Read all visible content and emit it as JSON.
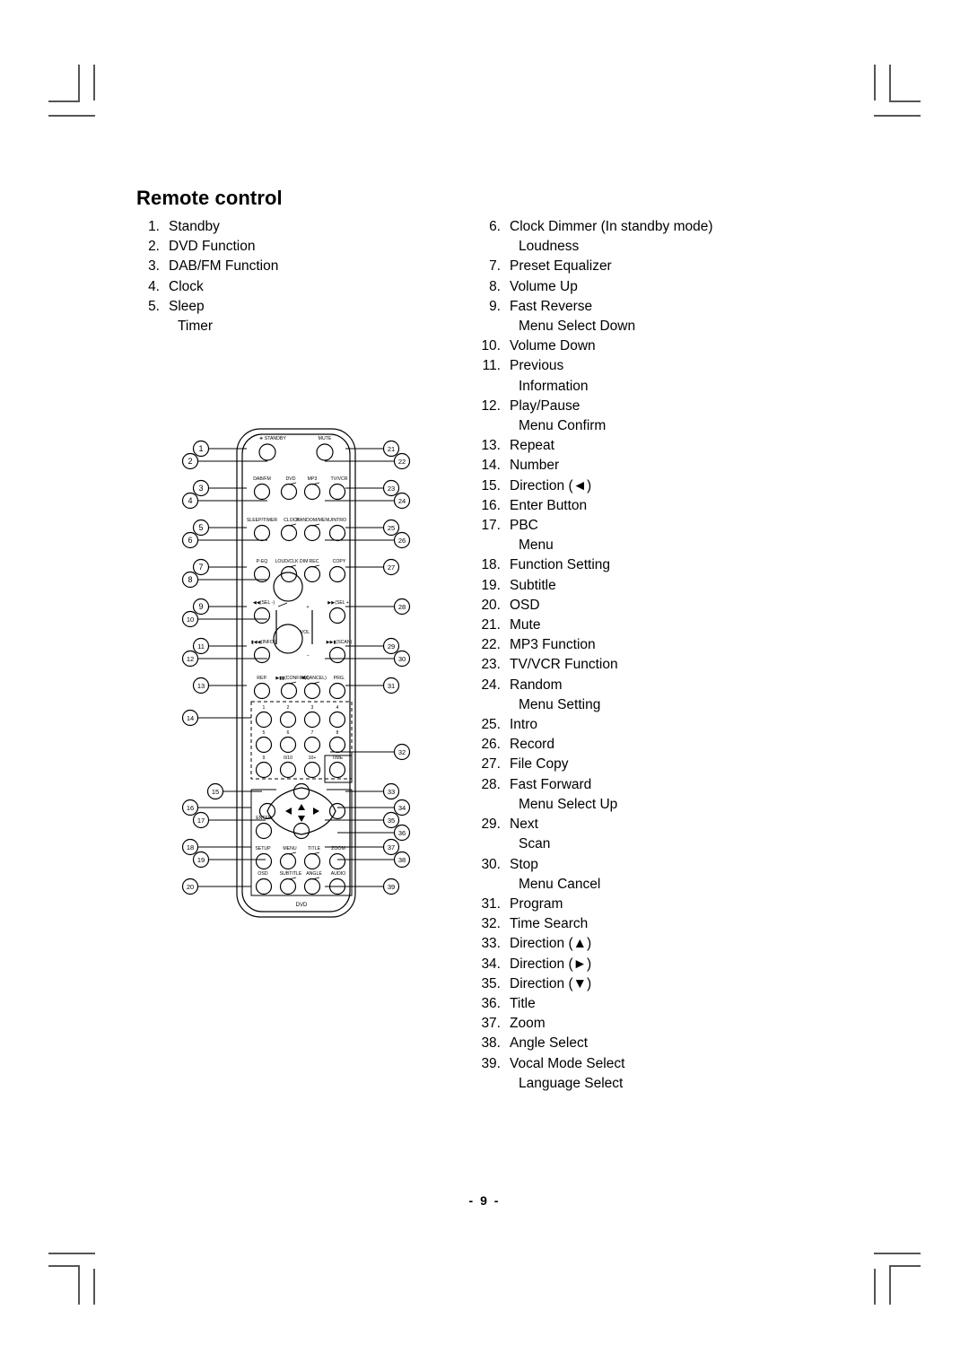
{
  "document": {
    "page_title": "Remote control",
    "page_number": "-  9  -"
  },
  "left_column": [
    {
      "num": "1.",
      "label": "Standby"
    },
    {
      "num": "2.",
      "label": "DVD Function"
    },
    {
      "num": "3.",
      "label": "DAB/FM Function"
    },
    {
      "num": "4.",
      "label": "Clock"
    },
    {
      "num": "5.",
      "label": "Sleep",
      "sub": "Timer"
    }
  ],
  "right_column": [
    {
      "num": "6.",
      "label": "Clock Dimmer (In standby mode)",
      "sub": "Loudness"
    },
    {
      "num": "7.",
      "label": "Preset Equalizer"
    },
    {
      "num": "8.",
      "label": "Volume Up"
    },
    {
      "num": "9.",
      "label": "Fast Reverse",
      "sub": "Menu Select Down"
    },
    {
      "num": "10.",
      "label": "Volume Down"
    },
    {
      "num": "11.",
      "label": "Previous",
      "sub": "Information"
    },
    {
      "num": "12.",
      "label": "Play/Pause",
      "sub": "Menu Confirm"
    },
    {
      "num": "13.",
      "label": "Repeat"
    },
    {
      "num": "14.",
      "label": "Number"
    },
    {
      "num": "15.",
      "label": "Direction  (◄)"
    },
    {
      "num": "16.",
      "label": "Enter Button"
    },
    {
      "num": "17.",
      "label": "PBC",
      "sub": "Menu"
    },
    {
      "num": "18.",
      "label": "Function Setting"
    },
    {
      "num": "19.",
      "label": "Subtitle"
    },
    {
      "num": "20.",
      "label": "OSD"
    },
    {
      "num": "21.",
      "label": "Mute"
    },
    {
      "num": "22.",
      "label": "MP3 Function"
    },
    {
      "num": "23.",
      "label": "TV/VCR Function"
    },
    {
      "num": "24.",
      "label": "Random",
      "sub": "Menu Setting"
    },
    {
      "num": "25.",
      "label": "Intro"
    },
    {
      "num": "26.",
      "label": "Record"
    },
    {
      "num": "27.",
      "label": "File Copy"
    },
    {
      "num": "28.",
      "label": "Fast Forward",
      "sub": "Menu Select Up"
    },
    {
      "num": "29.",
      "label": "Next",
      "sub": "Scan"
    },
    {
      "num": "30.",
      "label": "Stop",
      "sub": "Menu Cancel"
    },
    {
      "num": "31.",
      "label": "Program"
    },
    {
      "num": "32.",
      "label": "Time Search"
    },
    {
      "num": "33.",
      "label": "Direction  (▲)"
    },
    {
      "num": "34.",
      "label": "Direction  (►)"
    },
    {
      "num": "35.",
      "label": "Direction  (▼)"
    },
    {
      "num": "36.",
      "label": "Title"
    },
    {
      "num": "37.",
      "label": "Zoom"
    },
    {
      "num": "38.",
      "label": "Angle Select"
    },
    {
      "num": "39.",
      "label": "Vocal Mode Select",
      "sub": "Language Select"
    }
  ],
  "remote_diagram": {
    "button_labels": [
      "STANDBY",
      "MUTE",
      "DAB/FM",
      "DVD",
      "MP3",
      "TV/VCR",
      "SLEEP/TIMER",
      "CLOCK",
      "RANDOM/MENU",
      "INTRO",
      "P-EQ",
      "LOUD/CLK DIM",
      "REC",
      "COPY",
      "(SEL -)",
      "(SEL +)",
      "(INFO.)",
      "(SCAN)",
      "VOL",
      "+",
      "−",
      "REP.",
      "(CONFIRM)",
      "(CANCEL)",
      "PRG.",
      "1",
      "2",
      "3",
      "4",
      "5",
      "6",
      "7",
      "8",
      "9",
      "0/10",
      "10+",
      "TIME",
      "ENTER",
      "SETUP",
      "MENU",
      "TITLE",
      "ZOOM",
      "OSD",
      "SUBTITLE",
      "ANGLE",
      "AUDIO",
      "DVD"
    ],
    "callouts_left": [
      "1",
      "2",
      "3",
      "4",
      "5",
      "6",
      "7",
      "8",
      "9",
      "10",
      "11",
      "12",
      "13",
      "14",
      "15",
      "16",
      "17",
      "18",
      "19",
      "20"
    ],
    "callouts_right": [
      "21",
      "22",
      "23",
      "24",
      "25",
      "26",
      "27",
      "28",
      "29",
      "30",
      "31",
      "32",
      "33",
      "34",
      "35",
      "36",
      "37",
      "38",
      "39"
    ]
  },
  "colors": {
    "ink": "#000000",
    "page": "#ffffff",
    "crop_mark": "#555555"
  }
}
